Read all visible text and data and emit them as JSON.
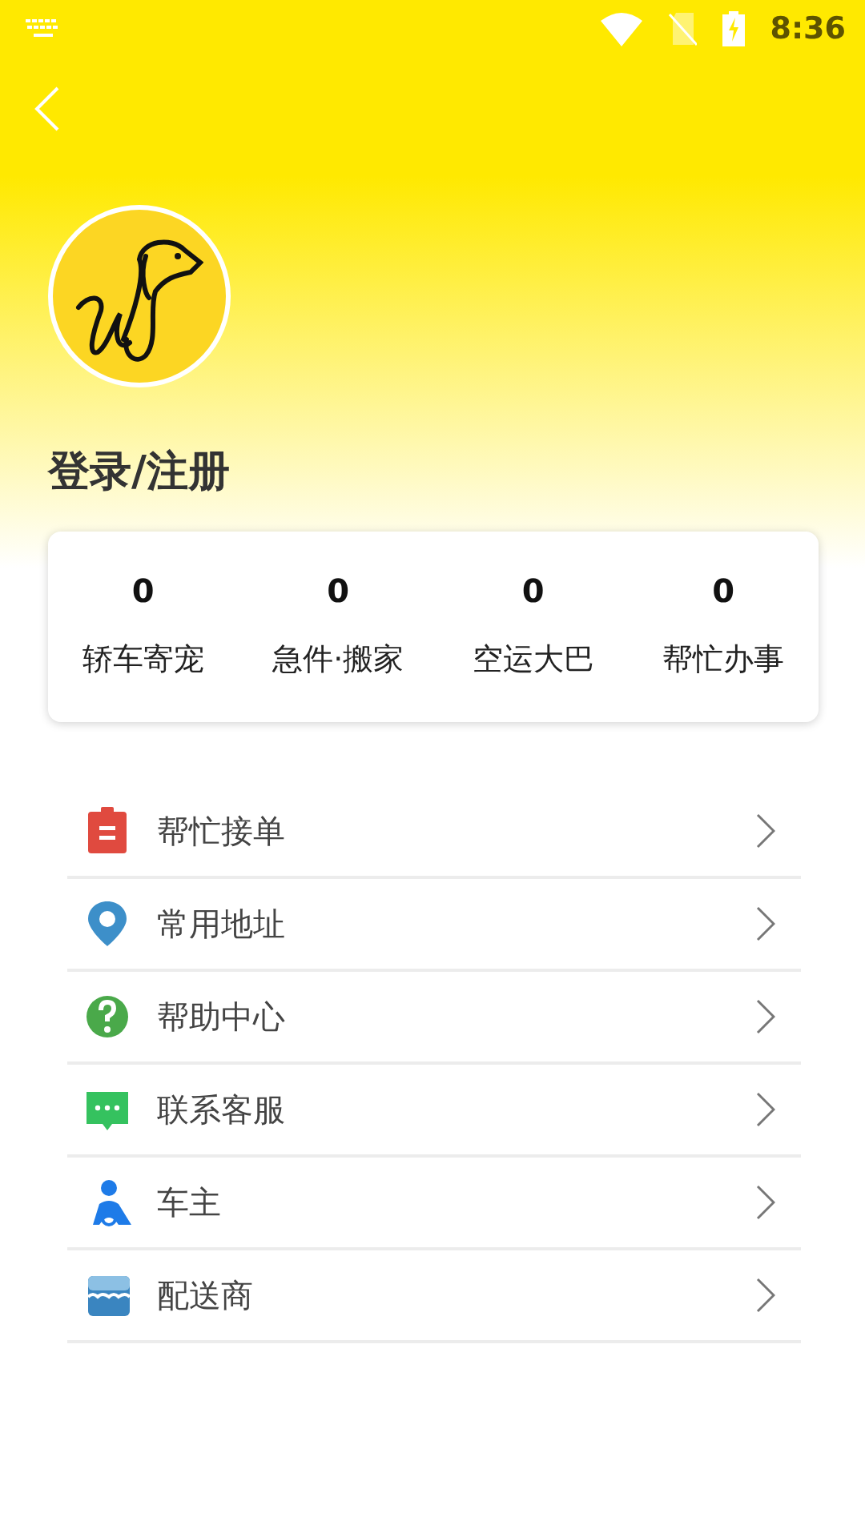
{
  "status_bar": {
    "time": "8:36"
  },
  "profile": {
    "login": "登录/注册"
  },
  "stats": [
    {
      "value": "0",
      "label": "轿车寄宠"
    },
    {
      "value": "0",
      "label": "急件·搬家"
    },
    {
      "value": "0",
      "label": "空运大巴"
    },
    {
      "value": "0",
      "label": "帮忙办事"
    }
  ],
  "menu": [
    {
      "kind": "clipboard",
      "label": "帮忙接单"
    },
    {
      "kind": "pin",
      "label": "常用地址"
    },
    {
      "kind": "help",
      "label": "帮助中心"
    },
    {
      "kind": "chat",
      "label": "联系客服"
    },
    {
      "kind": "driver",
      "label": "车主"
    },
    {
      "kind": "shop",
      "label": "配送商"
    }
  ]
}
